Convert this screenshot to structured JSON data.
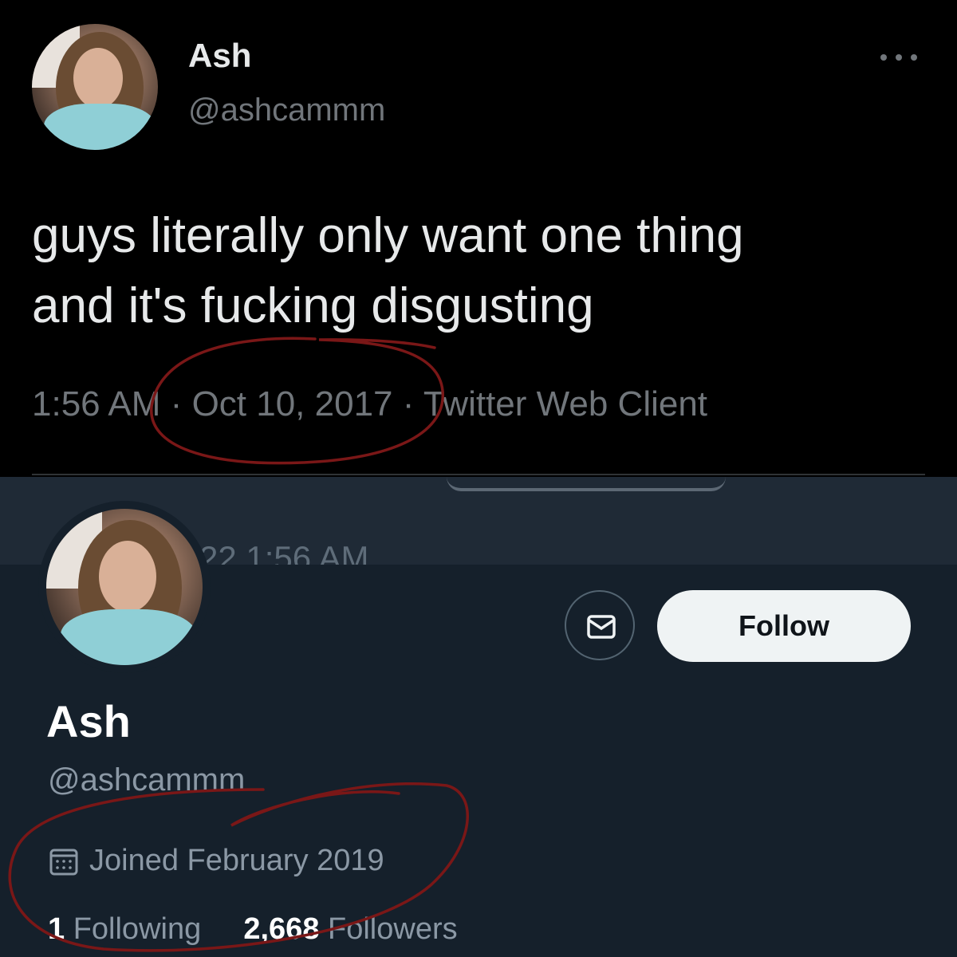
{
  "tweet": {
    "name": "Ash",
    "handle": "@ashcammm",
    "text_line1": "guys literally only want one thing",
    "text_line2": "and it's fucking disgusting",
    "time": "1:56 AM",
    "date": "Oct 10, 2017",
    "client": "Twitter Web Client",
    "separator": "·",
    "more_icon": "more-horizontal-icon"
  },
  "overlap": {
    "ghost_text": "22 1:56 AM"
  },
  "profile": {
    "follow_label": "Follow",
    "message_icon": "envelope-icon",
    "name": "Ash",
    "handle": "@ashcammm",
    "calendar_icon": "calendar-icon",
    "joined": "Joined February 2019",
    "following_count": "1",
    "following_label": "Following",
    "followers_count": "2,668",
    "followers_label": "Followers"
  },
  "colors": {
    "annotation": "#7a1717",
    "tweet_bg": "#000000",
    "profile_bg": "#15202b"
  }
}
